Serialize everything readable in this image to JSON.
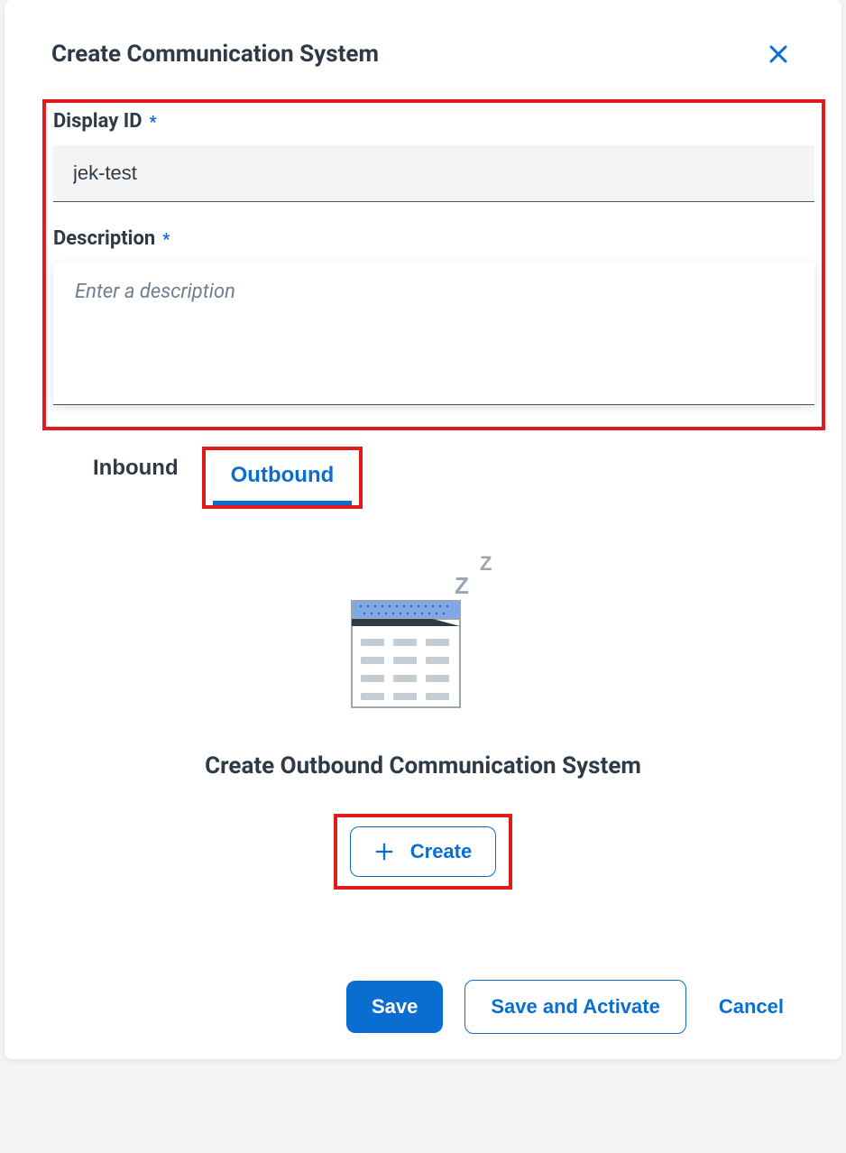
{
  "dialog": {
    "title": "Create Communication System"
  },
  "fields": {
    "display_id": {
      "label": "Display ID",
      "required_mark": "*",
      "value": "jek-test"
    },
    "description": {
      "label": "Description",
      "required_mark": "*",
      "placeholder": "Enter a description",
      "value": ""
    }
  },
  "tabs": {
    "inbound": "Inbound",
    "outbound": "Outbound"
  },
  "empty_state": {
    "title": "Create Outbound Communication System",
    "create_label": "Create"
  },
  "footer": {
    "save": "Save",
    "save_activate": "Save and Activate",
    "cancel": "Cancel"
  }
}
